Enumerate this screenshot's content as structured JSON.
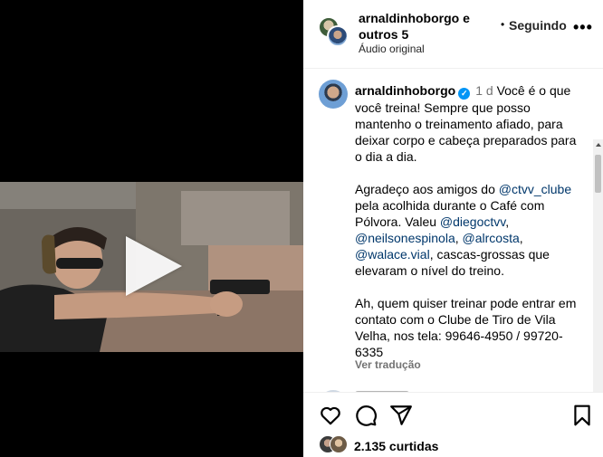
{
  "header": {
    "author_line": "arnaldinhoborgo e outros 5",
    "separator": "•",
    "follow_label": "Seguindo",
    "audio": "Áudio original",
    "more_icon": "•••"
  },
  "comment": {
    "username": "arnaldinhoborgo",
    "verified_glyph": "✓",
    "time": "1 d",
    "p1": "Você é o que você treina! Sempre que posso mantenho o treinamento afiado, para deixar corpo e cabeça preparados para o dia a dia.",
    "p2_a": "Agradeço aos amigos do ",
    "p2_m1": "@ctvv_clube",
    "p2_b": " pela acolhida durante o Café com Pólvora. Valeu ",
    "p2_m2": "@diegoctvv",
    "p2_c": ", ",
    "p2_m3": "@neilsonespinola",
    "p2_d": ", ",
    "p2_m4": "@alrcosta",
    "p2_e": ", ",
    "p2_m5": "@walace.vial",
    "p2_f": ", cascas-grossas que elevaram o nível do treino.",
    "p3": "Ah, quem quiser treinar pode entrar em contato com o Clube de Tiro de Vila Velha, nos tela: 99646-4950 / 99720-6335",
    "translate": "Ver tradução"
  },
  "likes": {
    "text": "2.135 curtidas"
  },
  "icons": {
    "like": "heart-icon",
    "comment": "comment-icon",
    "share": "share-icon",
    "save": "bookmark-icon",
    "play": "play-icon",
    "more": "more-icon"
  },
  "colors": {
    "mention": "#00376b",
    "verified": "#0095f6",
    "muted": "#737373"
  }
}
